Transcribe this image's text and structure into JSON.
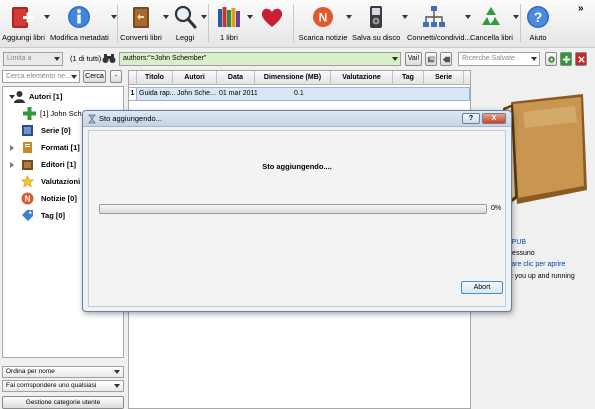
{
  "toolbar": {
    "items": [
      {
        "label": "Aggiungi libri",
        "icon": "add-books-icon"
      },
      {
        "label": "Modifica metadati",
        "icon": "info-icon"
      },
      {
        "label": "Converti libri",
        "icon": "convert-book-icon"
      },
      {
        "label": "Leggi",
        "icon": "magnifier-icon"
      },
      {
        "label": "1 libri",
        "icon": "library-shelf-icon"
      },
      {
        "label": "",
        "icon": "heart-icon"
      },
      {
        "label": "Scarica notizie",
        "icon": "news-icon"
      },
      {
        "label": "Salva su disco",
        "icon": "ipod-icon"
      },
      {
        "label": "Connetti/condivid...",
        "icon": "network-icon"
      },
      {
        "label": "Cancella libri",
        "icon": "recycle-icon"
      },
      {
        "label": "Aiuto",
        "icon": "help-icon"
      }
    ],
    "more": "»"
  },
  "search": {
    "restrict_placeholder": "Limita a",
    "count": "(1 di tutti)",
    "query": "authors:\"=John Schember\"",
    "go_label": "Vai!",
    "saved_placeholder": "Ricerche Salvate"
  },
  "left": {
    "find_placeholder": "Cerca elemento ne...",
    "find_button": "Cerca",
    "minus_button": "-",
    "tree": [
      {
        "label": "Autori [1]",
        "icon": "author-icon",
        "expanded": true
      },
      {
        "label": "[1] John Sch",
        "icon": "plus-icon",
        "child": true
      },
      {
        "label": "Serie [0]",
        "icon": "series-icon"
      },
      {
        "label": "Formati [1]",
        "icon": "formats-icon",
        "expandable": true
      },
      {
        "label": "Editori [1]",
        "icon": "publisher-icon",
        "expandable": true
      },
      {
        "label": "Valutazioni [0]",
        "icon": "star-icon"
      },
      {
        "label": "Notizie [0]",
        "icon": "news-small-icon"
      },
      {
        "label": "Tag [0]",
        "icon": "tag-icon"
      }
    ],
    "sort_by": "Ordina per nome",
    "match": "Fai corrispondere uno qualsiasi",
    "manage": "Gestione categorie utente"
  },
  "table": {
    "headers": [
      "Titolo",
      "Autori",
      "Data",
      "Dimensione (MB)",
      "Valutazione",
      "Tag",
      "Serie"
    ],
    "rows": [
      {
        "num": "1",
        "cells": [
          "Guida rap...",
          "John Sche...",
          "01 mar 2011",
          "0.1",
          "",
          "",
          ""
        ]
      }
    ]
  },
  "details": {
    "format": "EPUB",
    "value": "Nessuno",
    "open_hint": "Fare clic per aprire",
    "comment": "et you up and running"
  },
  "dialog": {
    "title": "Sto aggiungendo...",
    "message": "Sto aggiungendo....",
    "progress": 0,
    "progress_text": "0%",
    "abort_label": "Abort",
    "help_btn": "?",
    "close_btn": "X"
  },
  "colors": {
    "selection": "#dbe6f5",
    "link": "#0645ad",
    "search_bg": "#d8f0c8"
  }
}
